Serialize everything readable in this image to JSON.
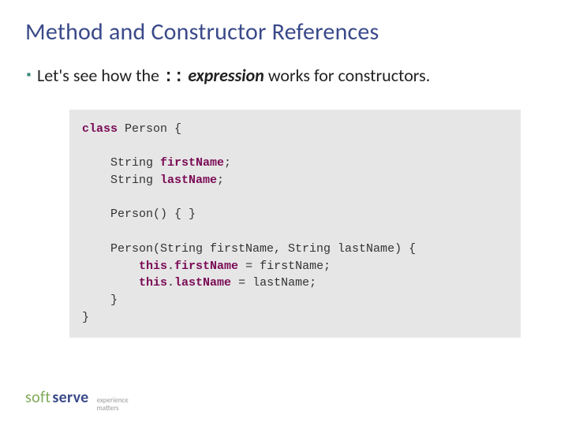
{
  "title": "Method and Constructor References",
  "bullet": {
    "pre": "Let's see how the ",
    "op": "::",
    "emph": " expression",
    "post": " works for constructors."
  },
  "code": {
    "l1_kw": "class",
    "l1_rest": " Person {",
    "l3_pre": "    String ",
    "l3_fld": "firstName",
    "l3_post": ";",
    "l4_pre": "    String ",
    "l4_fld": "lastName",
    "l4_post": ";",
    "l6": "    Person() { }",
    "l8": "    Person(String firstName, String lastName) {",
    "l9_pre": "        ",
    "l9_this": "this",
    "l9_dot": ".",
    "l9_fld": "firstName",
    "l9_post": " = firstName;",
    "l10_pre": "        ",
    "l10_this": "this",
    "l10_dot": ".",
    "l10_fld": "lastName",
    "l10_post": " = lastName;",
    "l11": "    }",
    "l12": "}"
  },
  "footer": {
    "soft": "soft",
    "serve": "serve",
    "tag1": "experience",
    "tag2": "matters"
  }
}
